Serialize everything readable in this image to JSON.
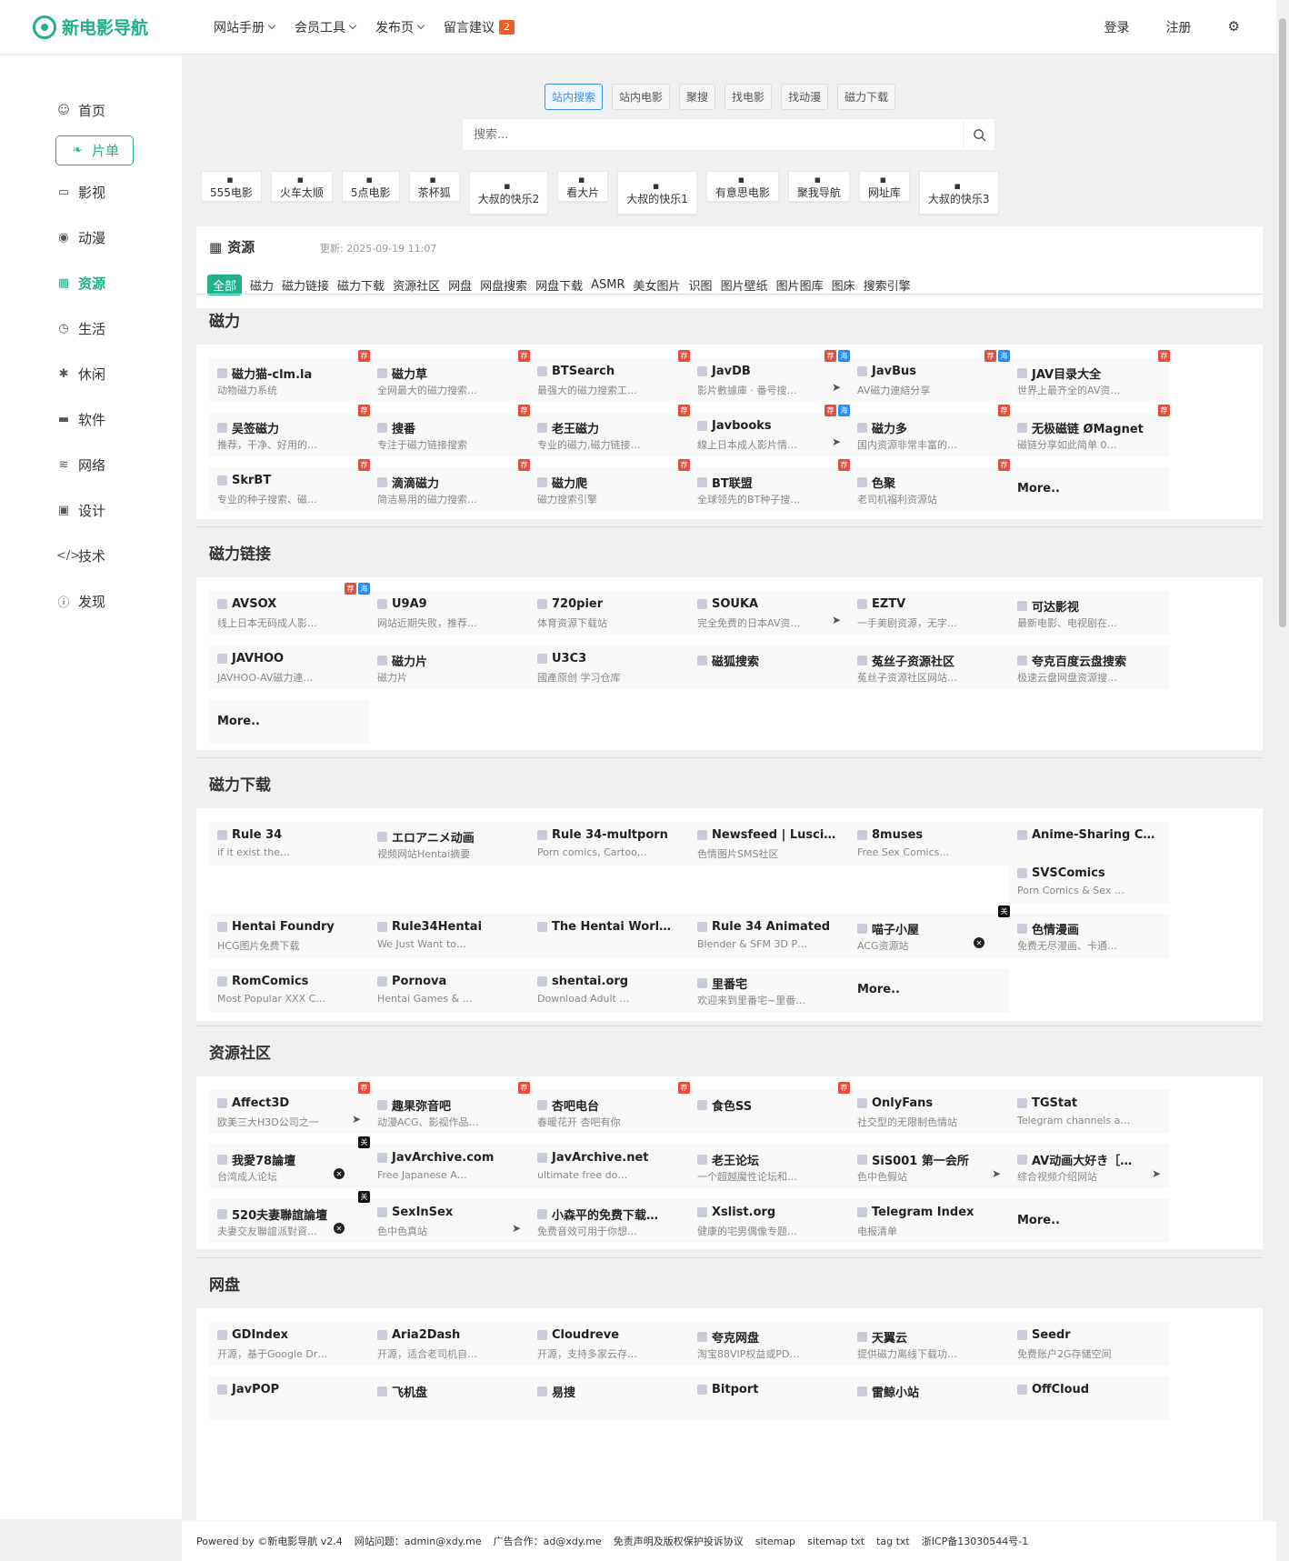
{
  "brand": {
    "name": "新电影导航"
  },
  "nav": {
    "items": [
      {
        "label": "网站手册"
      },
      {
        "label": "会员工具"
      },
      {
        "label": "发布页"
      },
      {
        "label": "留言建议",
        "badge": "2"
      }
    ],
    "login": "登录",
    "register": "注册"
  },
  "sidebar": {
    "items": [
      {
        "label": "首页",
        "icon": "smile-icon"
      },
      {
        "label": "片单",
        "icon": "leaf-icon"
      },
      {
        "label": "影视",
        "icon": "video-icon"
      },
      {
        "label": "动漫",
        "icon": "gamepad-icon"
      },
      {
        "label": "资源",
        "icon": "grid-icon"
      },
      {
        "label": "生活",
        "icon": "clock-icon"
      },
      {
        "label": "休闲",
        "icon": "palm-icon"
      },
      {
        "label": "软件",
        "icon": "monitor-icon"
      },
      {
        "label": "网络",
        "icon": "layers-icon"
      },
      {
        "label": "设计",
        "icon": "image-icon"
      },
      {
        "label": "技术",
        "icon": "code-icon"
      },
      {
        "label": "发现",
        "icon": "info-icon"
      }
    ]
  },
  "search": {
    "tabs": [
      "站内搜索",
      "站内电影",
      "聚搜",
      "找电影",
      "找动漫",
      "磁力下载"
    ],
    "placeholder": "搜索..."
  },
  "quick_links": [
    {
      "label": "555电影"
    },
    {
      "label": "火车太顺"
    },
    {
      "label": "5点电影"
    },
    {
      "label": "茶杯狐"
    },
    {
      "label": "大叔的快乐2"
    },
    {
      "label": "看大片"
    },
    {
      "label": "大叔的快乐1"
    },
    {
      "label": "有意思电影"
    },
    {
      "label": "聚我导航"
    },
    {
      "label": "网址库"
    },
    {
      "label": "大叔的快乐3"
    }
  ],
  "resource": {
    "title": "资源",
    "update_label": "更新:",
    "update_time": "2025-09-19 11:07",
    "filters": [
      "全部",
      "磁力",
      "磁力链接",
      "磁力下载",
      "资源社区",
      "网盘",
      "网盘搜索",
      "网盘下载",
      "ASMR",
      "美女图片",
      "识图",
      "图片壁纸",
      "图片图库",
      "图床",
      "搜索引擎"
    ]
  },
  "tag_labels": {
    "jian": "荐",
    "hai": "海",
    "guan": "关"
  },
  "sections": [
    {
      "title": "磁力",
      "cards": [
        {
          "name": "磁力猫-clm.la",
          "desc": "动物磁力系统",
          "tags": [
            "jian"
          ]
        },
        {
          "name": "磁力草",
          "desc": "全网最大的磁力搜索…",
          "tags": [
            "jian"
          ]
        },
        {
          "name": "BTSearch",
          "desc": "最强大的磁力搜索工…",
          "tags": [
            "jian"
          ]
        },
        {
          "name": "JavDB",
          "desc": "影片數據庫 · 番号搜…",
          "tags": [
            "jian",
            "hai"
          ],
          "act": "send"
        },
        {
          "name": "JavBus",
          "desc": "AV磁力連結分享",
          "tags": [
            "jian",
            "hai"
          ]
        },
        {
          "name": "JAV目录大全",
          "desc": "世界上最齐全的AV资…",
          "tags": [
            "jian"
          ]
        },
        {
          "name": "吴签磁力",
          "desc": "推荐，干净、好用的…",
          "tags": [
            "jian"
          ]
        },
        {
          "name": "搜番",
          "desc": "专注于磁力链接搜索",
          "tags": [
            "jian"
          ]
        },
        {
          "name": "老王磁力",
          "desc": "专业的磁力,磁力链接…",
          "tags": [
            "jian"
          ]
        },
        {
          "name": "Javbooks",
          "desc": "線上日本成人影片情…",
          "tags": [
            "jian",
            "hai"
          ],
          "act": "send"
        },
        {
          "name": "磁力多",
          "desc": "国内资源非常丰富的…",
          "tags": [
            "jian"
          ]
        },
        {
          "name": "无极磁链 ØMagnet",
          "desc": "磁链分享如此简单 0…",
          "tags": [
            "jian"
          ]
        },
        {
          "name": "SkrBT",
          "desc": "专业的种子搜索、磁…",
          "tags": [
            "jian"
          ]
        },
        {
          "name": "滴滴磁力",
          "desc": "简洁易用的磁力搜索…",
          "tags": [
            "jian"
          ]
        },
        {
          "name": "磁力爬",
          "desc": "磁力搜索引擎",
          "tags": [
            "jian"
          ]
        },
        {
          "name": "BT联盟",
          "desc": "全球领先的BT种子搜…",
          "tags": [
            "jian"
          ]
        },
        {
          "name": "色聚",
          "desc": "老司机福利资源站",
          "tags": [
            "jian"
          ]
        },
        {
          "name": "More..",
          "desc": "",
          "tags": [],
          "more": true
        }
      ]
    },
    {
      "title": "磁力链接",
      "cards": [
        {
          "name": "AVSOX",
          "desc": "线上日本无码成人影…",
          "tags": [
            "jian",
            "hai"
          ]
        },
        {
          "name": "U9A9",
          "desc": "网站近期失败，推荐…",
          "tags": []
        },
        {
          "name": "720pier",
          "desc": "体育资源下载站",
          "tags": []
        },
        {
          "name": "SOUKA",
          "desc": "完全免费的日本AV资…",
          "tags": [],
          "act": "send"
        },
        {
          "name": "EZTV",
          "desc": "一手美剧资源，无字…",
          "tags": []
        },
        {
          "name": "可达影视",
          "desc": "最新电影、电视剧在…",
          "tags": []
        },
        {
          "name": "JAVHOO",
          "desc": "JAVHOO-AV磁力連…",
          "tags": []
        },
        {
          "name": "磁力片",
          "desc": "磁力片",
          "tags": []
        },
        {
          "name": "U3C3",
          "desc": "國產原创 学习仓库",
          "tags": []
        },
        {
          "name": "磁狐搜索",
          "desc": "",
          "tags": []
        },
        {
          "name": "菟丝子资源社区",
          "desc": "菟丝子资源社区网站…",
          "tags": []
        },
        {
          "name": "夸克百度云盘搜索",
          "desc": "极速云盘网盘资源搜…",
          "tags": []
        },
        {
          "name": "More..",
          "desc": "",
          "tags": [],
          "more": true
        }
      ]
    },
    {
      "title": "磁力下载",
      "cards": [
        {
          "name": "Rule 34",
          "desc": "if it exist the…",
          "tags": []
        },
        {
          "name": "エロアニメ动画",
          "desc": "视频网站Hentai摘要",
          "tags": []
        },
        {
          "name": "Rule 34-multporn",
          "desc": "Porn comics, Cartoo…",
          "tags": []
        },
        {
          "name": "Newsfeed | Lusci…",
          "desc": "色情图片SMS社区",
          "tags": []
        },
        {
          "name": "8muses",
          "desc": "Free Sex Comics…",
          "tags": []
        },
        {
          "name": "Anime-Sharing C…",
          "desc": "",
          "tags": []
        },
        {
          "name": "SVSComics",
          "desc": "Porn Comics & Sex …",
          "tags": []
        },
        {
          "name": "Hentai Foundry",
          "desc": "HCG图片免费下载",
          "tags": []
        },
        {
          "name": "Rule34Hentai",
          "desc": "We Just Want to…",
          "tags": []
        },
        {
          "name": "The Hentai Worl…",
          "desc": "",
          "tags": []
        },
        {
          "name": "Rule 34 Animated",
          "desc": "Blender & SFM 3D P…",
          "tags": []
        },
        {
          "name": "喵子小屋",
          "desc": "ACG资源站",
          "tags": [
            "guan"
          ],
          "act": "x"
        },
        {
          "name": "色情漫画",
          "desc": "免费无尽漫画、卡通…",
          "tags": []
        },
        {
          "name": "RomComics",
          "desc": "Most Popular XXX C…",
          "tags": []
        },
        {
          "name": "Pornova",
          "desc": "Hentai Games & …",
          "tags": []
        },
        {
          "name": "shentai.org",
          "desc": "Download Adult …",
          "tags": []
        },
        {
          "name": "里番宅",
          "desc": "欢迎来到里番宅~里番…",
          "tags": []
        },
        {
          "name": "More..",
          "desc": "",
          "tags": [],
          "more": true
        }
      ]
    },
    {
      "title": "资源社区",
      "cards": [
        {
          "name": "Affect3D",
          "desc": "欧美三大H3D公司之一",
          "tags": [
            "jian"
          ],
          "act": "send"
        },
        {
          "name": "趣果弥音吧",
          "desc": "动漫ACG、影视作品…",
          "tags": [
            "jian"
          ]
        },
        {
          "name": "杏吧电台",
          "desc": "春暖花开 杏吧有你",
          "tags": [
            "jian"
          ]
        },
        {
          "name": "食色SS",
          "desc": "",
          "tags": [
            "jian"
          ]
        },
        {
          "name": "OnlyFans",
          "desc": "社交型的无限制色情站",
          "tags": []
        },
        {
          "name": "TGStat",
          "desc": "Telegram channels a…",
          "tags": []
        },
        {
          "name": "我愛78論壇",
          "desc": "台湾成人论坛",
          "tags": [
            "guan"
          ],
          "act": "x"
        },
        {
          "name": "JavArchive.com",
          "desc": "Free Japanese A…",
          "tags": []
        },
        {
          "name": "JavArchive.net",
          "desc": "ultimate free do…",
          "tags": []
        },
        {
          "name": "老王论坛",
          "desc": "一个超越魔性论坛和…",
          "tags": []
        },
        {
          "name": "SiS001 第一会所",
          "desc": "色中色假站",
          "tags": [],
          "act": "send"
        },
        {
          "name": "AV动画大好き［…",
          "desc": "综合视频介绍网站",
          "tags": [],
          "act": "send"
        },
        {
          "name": "520夫妻聯誼論壇",
          "desc": "夫妻交友聯誼派對資…",
          "tags": [
            "guan"
          ],
          "act": "x"
        },
        {
          "name": "SexInSex",
          "desc": "色中色真站",
          "tags": [],
          "act": "send"
        },
        {
          "name": "小森平的免费下载…",
          "desc": "免费音效可用于你想…",
          "tags": []
        },
        {
          "name": "Xslist.org",
          "desc": "健康的宅男偶像专题…",
          "tags": []
        },
        {
          "name": "Telegram Index",
          "desc": "电报清单",
          "tags": []
        },
        {
          "name": "More..",
          "desc": "",
          "tags": [],
          "more": true
        }
      ]
    },
    {
      "title": "网盘",
      "cards": [
        {
          "name": "GDIndex",
          "desc": "开源，基于Google Dr…",
          "tags": []
        },
        {
          "name": "Aria2Dash",
          "desc": "开源，适合老司机自…",
          "tags": []
        },
        {
          "name": "Cloudreve",
          "desc": "开源，支持多家云存…",
          "tags": []
        },
        {
          "name": "夸克网盘",
          "desc": "淘宝88VIP权益或PD…",
          "tags": []
        },
        {
          "name": "天翼云",
          "desc": "提供磁力离线下载功…",
          "tags": []
        },
        {
          "name": "Seedr",
          "desc": "免费账户2G存储空间",
          "tags": []
        },
        {
          "name": "JavPOP",
          "desc": "",
          "tags": []
        },
        {
          "name": "飞机盘",
          "desc": "",
          "tags": []
        },
        {
          "name": "易搜",
          "desc": "",
          "tags": []
        },
        {
          "name": "Bitport",
          "desc": "",
          "tags": []
        },
        {
          "name": "雷鲸小站",
          "desc": "",
          "tags": []
        },
        {
          "name": "OffCloud",
          "desc": "",
          "tags": []
        }
      ]
    }
  ],
  "footer": {
    "items": [
      "Powered by ©新电影导航 v2.4",
      "网站问题：admin@xdy.me",
      "广告合作：ad@xdy.me",
      "免责声明及版权保护投诉协议",
      "sitemap",
      "sitemap txt",
      "tag txt",
      "浙ICP备13030544号-1"
    ]
  },
  "colors": {
    "accent": "#21b08a",
    "tab_active": "#3a8ee6",
    "badge": "#f05c24",
    "tag_jian": "#e74c3c",
    "tag_hai": "#2d8cf0"
  }
}
